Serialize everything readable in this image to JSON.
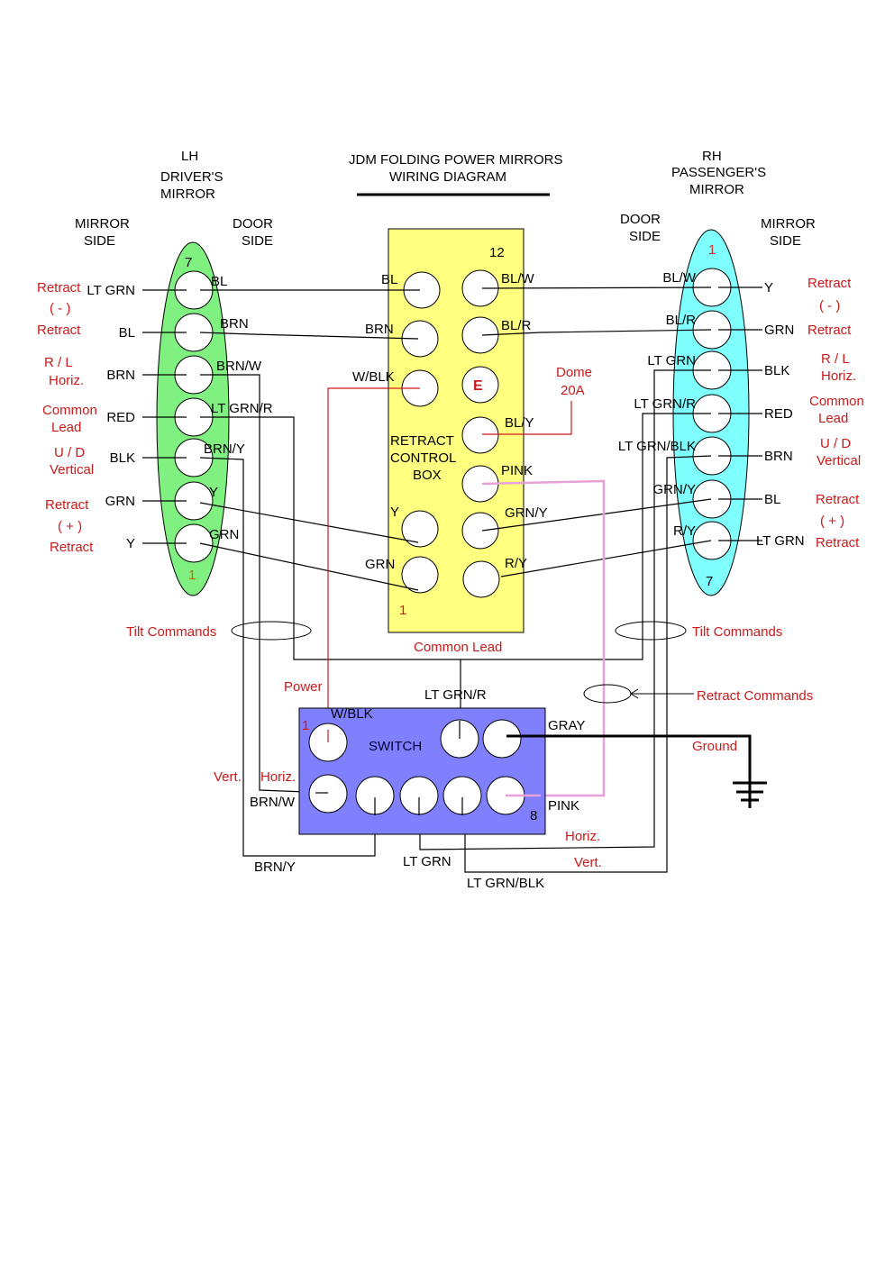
{
  "title": {
    "line1": "JDM FOLDING POWER MIRRORS",
    "line2": "WIRING DIAGRAM"
  },
  "colors": {
    "lh_mirror": "#80f080",
    "rh_mirror": "#80ffff",
    "control_box": "#ffff80",
    "switch": "#8080ff",
    "annotation": "#cc1a1a",
    "pink_wire": "#e8a0d8",
    "power_wire": "#cc1a1a"
  },
  "lh": {
    "header": [
      "LH",
      "DRIVER'S",
      "MIRROR"
    ],
    "mirror_side": [
      "MIRROR",
      "SIDE"
    ],
    "door_side": [
      "DOOR",
      "SIDE"
    ],
    "pin_top": "7",
    "pin_bottom": "1",
    "pins": [
      {
        "mirror_wire": "LT GRN",
        "door_wire": "BL"
      },
      {
        "mirror_wire": "BL",
        "door_wire": "BRN"
      },
      {
        "mirror_wire": "BRN",
        "door_wire": "BRN/W"
      },
      {
        "mirror_wire": "RED",
        "door_wire": "LT GRN/R"
      },
      {
        "mirror_wire": "BLK",
        "door_wire": "BRN/Y"
      },
      {
        "mirror_wire": "GRN",
        "door_wire": "Y"
      },
      {
        "mirror_wire": "Y",
        "door_wire": "GRN"
      }
    ],
    "functions": {
      "retract_neg": [
        "Retract",
        "( - )",
        "Retract"
      ],
      "horiz": [
        "R / L",
        "Horiz."
      ],
      "common": [
        "Common",
        "Lead"
      ],
      "vert": [
        "U / D",
        "Vertical"
      ],
      "retract_pos": [
        "Retract",
        "( + )",
        "Retract"
      ]
    }
  },
  "rh": {
    "header": [
      "RH",
      "PASSENGER'S",
      "MIRROR"
    ],
    "mirror_side": [
      "MIRROR",
      "SIDE"
    ],
    "door_side": [
      "DOOR",
      "SIDE"
    ],
    "pin_top": "1",
    "pin_bottom": "7",
    "pins": [
      {
        "mirror_wire": "Y",
        "door_wire": "BL/W"
      },
      {
        "mirror_wire": "GRN",
        "door_wire": "BL/R"
      },
      {
        "mirror_wire": "BLK",
        "door_wire": "LT GRN"
      },
      {
        "mirror_wire": "RED",
        "door_wire": "LT GRN/R"
      },
      {
        "mirror_wire": "BRN",
        "door_wire": "LT GRN/BLK"
      },
      {
        "mirror_wire": "BL",
        "door_wire": "GRN/Y"
      },
      {
        "mirror_wire": "LT GRN",
        "door_wire": "R/Y"
      }
    ],
    "functions": {
      "retract_neg": [
        "Retract",
        "( - )",
        "Retract"
      ],
      "horiz": [
        "R / L",
        "Horiz."
      ],
      "common": [
        "Common",
        "Lead"
      ],
      "vert": [
        "U / D",
        "Vertical"
      ],
      "retract_pos": [
        "Retract",
        "( + )",
        "Retract"
      ]
    }
  },
  "control_box": {
    "label": [
      "RETRACT",
      "CONTROL",
      "BOX"
    ],
    "pin_top": "12",
    "pin_bottom": "1",
    "left_pins": [
      "BL",
      "BRN",
      "W/BLK",
      "Y",
      "GRN"
    ],
    "right_pins": [
      "BL/W",
      "BL/R",
      "E",
      "BL/Y",
      "PINK",
      "GRN/Y",
      "R/Y"
    ],
    "dome": [
      "Dome",
      "20A"
    ],
    "common_lead": "Common Lead"
  },
  "switch": {
    "label": "SWITCH",
    "pin_first": "1",
    "pin_last": "8",
    "wires": {
      "power_in": "W/BLK",
      "common": "LT GRN/R",
      "gray": "GRAY",
      "brn_w": "BRN/W",
      "brn_y": "BRN/Y",
      "lt_grn": "LT GRN",
      "lt_grn_blk": "LT GRN/BLK",
      "pink": "PINK"
    }
  },
  "annotations": {
    "tilt_left": "Tilt Commands",
    "tilt_right": "Tilt Commands",
    "retract_commands": "Retract Commands",
    "power": "Power",
    "ground": "Ground",
    "vert_left": "Vert.",
    "horiz_left": "Horiz.",
    "horiz_right": "Horiz.",
    "vert_right": "Vert."
  }
}
